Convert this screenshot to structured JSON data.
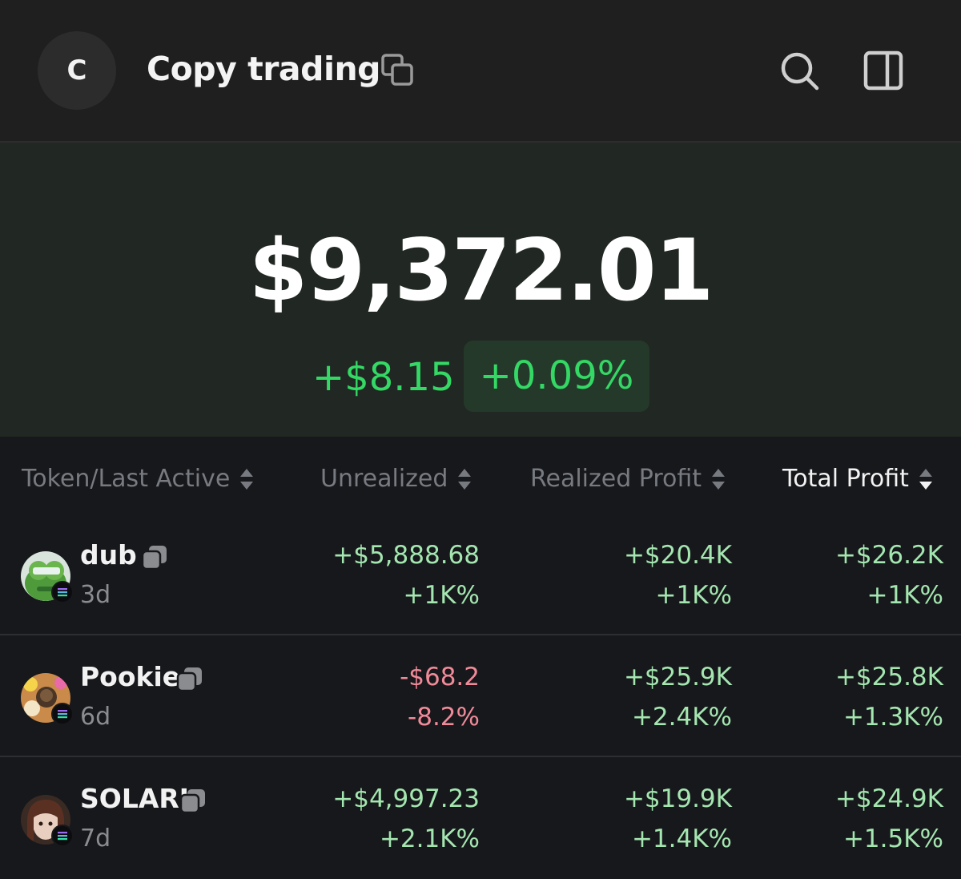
{
  "header": {
    "avatar_letter": "C",
    "title": "Copy trading"
  },
  "balance": {
    "total": "$9,372.01",
    "change_amount": "+$8.15",
    "change_percent": "+0.09%"
  },
  "table": {
    "columns": [
      {
        "label": "Token/Last Active",
        "active": false
      },
      {
        "label": "Unrealized",
        "active": false
      },
      {
        "label": "Realized Profit",
        "active": false
      },
      {
        "label": "Total Profit",
        "active": true
      }
    ],
    "rows": [
      {
        "token": "dub",
        "last_active": "3d",
        "unrealized": "+$5,888.68",
        "unrealized_pct": "+1K%",
        "realized": "+$20.4K",
        "realized_pct": "+1K%",
        "total": "+$26.2K",
        "total_pct": "+1K%"
      },
      {
        "token": "Pookie",
        "last_active": "6d",
        "unrealized": "-$68.2",
        "unrealized_pct": "-8.2%",
        "realized": "+$25.9K",
        "realized_pct": "+2.4K%",
        "total": "+$25.8K",
        "total_pct": "+1.3K%"
      },
      {
        "token": "SOLARI",
        "last_active": "7d",
        "unrealized": "+$4,997.23",
        "unrealized_pct": "+2.1K%",
        "realized": "+$19.9K",
        "realized_pct": "+1.4K%",
        "total": "+$24.9K",
        "total_pct": "+1.5K%"
      }
    ]
  },
  "colors": {
    "positive": "#a4e6b0",
    "negative": "#f08a99",
    "accent_green": "#34d865"
  }
}
